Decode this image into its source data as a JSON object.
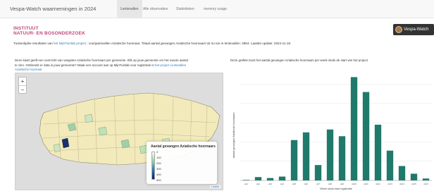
{
  "navbar": {
    "brand": "Vespa-Watch waarnemingen in 2024",
    "tabs": [
      {
        "label": "Lentevallen",
        "active": true
      },
      {
        "label": "Alle observaties",
        "active": false
      },
      {
        "label": "Statistieken",
        "active": false
      },
      {
        "label": "memory usage",
        "active": false
      }
    ]
  },
  "logo": {
    "line1": "INSTITUUT",
    "line2": "NATUUR- EN BOSONDERZOEK"
  },
  "vespa_button": {
    "label": "Vespa-Watch"
  },
  "intro": {
    "prefix": "Tussentijdse resultaten van",
    "link": "het MijnTuinlab project",
    "suffix": ": voorjaarsvallen Aziatische hoornaar. Totaal aantal gevangen Aziatische hoornaars tot nu toe in lentevallen: 3964. Laatste update: 2024-11-16."
  },
  "map_section": {
    "description_line1": "Deze kaart geeft een overzicht van vangsten Aziatische hoornaars per gemeente. Klik op jouw gemeente om het exacte aantal",
    "description_line2_prefix": "te zien. Ontbreekt er data in jouw gemeente? Maak een account aan op MijnTuinlab voor registratie in",
    "description_line2_link": "het project Lentevallen",
    "description_line3_link": "Aziatische hoornaar",
    "zoom_in": "+",
    "zoom_out": "−",
    "attribution": "Leaflet",
    "legend": {
      "title": "Aantal gevangen Aziatische hoornaars",
      "ticks": [
        "0",
        "100",
        "200",
        "300",
        "400",
        "500"
      ],
      "colors": [
        "#ffffff",
        "#bde2b6",
        "#7cc7a8",
        "#2f8bbd",
        "#1b4a9a",
        "#0a1f63"
      ]
    }
  },
  "chart_section": {
    "description": "Deze grafiek toont het aantal gevangen Aziatische hoornaars per week sinds de start van het project"
  },
  "chart_data": {
    "type": "bar",
    "title": "",
    "xlabel": "Week sinds start registratie",
    "ylabel": "Aantal gevangen Aziatische hoornaars",
    "categories": [
      "wk1",
      "wk2",
      "wk3",
      "wk4",
      "wk5",
      "wk6",
      "wk7",
      "wk8",
      "wk9",
      "wk10",
      "wk11",
      "wk12",
      "wk13",
      "wk14",
      "wk15",
      "wk16"
    ],
    "values": [
      5,
      35,
      25,
      40,
      420,
      500,
      160,
      530,
      460,
      1075,
      920,
      580,
      310,
      150,
      70,
      20
    ],
    "ylim": [
      0,
      1100
    ],
    "bar_color": "#1f7a6b",
    "grid": true
  }
}
